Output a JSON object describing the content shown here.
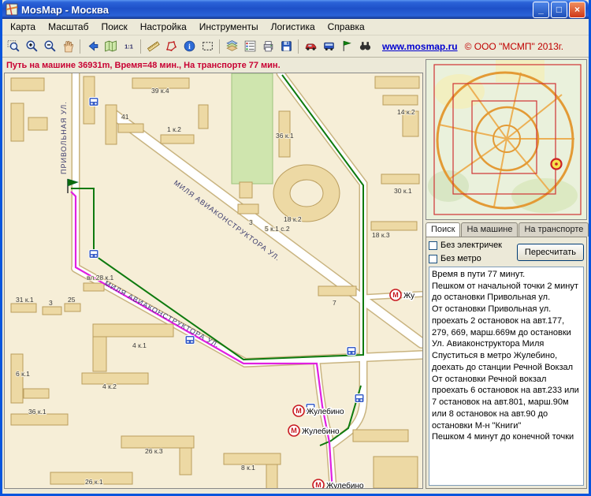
{
  "window": {
    "title": "MosMap - Москва",
    "controls": {
      "minimize": "_",
      "maximize": "□",
      "close": "×"
    }
  },
  "menu": {
    "items": [
      "Карта",
      "Масштаб",
      "Поиск",
      "Настройка",
      "Инструменты",
      "Логистика",
      "Справка"
    ]
  },
  "toolbar": {
    "icons": [
      "zoom-window",
      "zoom-in",
      "zoom-out",
      "pan-hand",
      "previous-view",
      "full-extent",
      "scale",
      "ruler",
      "measure-area",
      "object-info",
      "select-area",
      "layers",
      "legend",
      "print",
      "save",
      "car-route",
      "bus-route",
      "start-flag",
      "find-binoculars"
    ],
    "link": "www.mosmap.ru",
    "copyright": "© ООО \"МСМП\" 2013г."
  },
  "statusbar": {
    "route_summary": "Путь на машине 36931m, Время=48 мин., На транспорте 77 мин."
  },
  "map": {
    "streets": [
      "ПРИВОЛЬНАЯ УЛ.",
      "МИЛЯ АВИАКОНСТРУКТОРА УЛ.",
      "МИЛЯ АВИАКОНСТРУКТОРА УЛ."
    ],
    "buildings": [
      "39 к.4",
      "41",
      "1 к.2",
      "36 к.1",
      "14 к.2",
      "30 к.1",
      "18 к.2",
      "3",
      "5 к.1 с.2",
      "18 к.3",
      "7",
      "вл.28 к.1",
      "31 к.1",
      "3",
      "25",
      "4 к.1",
      "4 к.2",
      "6 к.1",
      "36 к.1",
      "26 к.3",
      "8 к.1",
      "26 к.1"
    ],
    "metro_stations": [
      "Жулебино",
      "Жулебино",
      "Жулебино",
      "Жу"
    ],
    "colors": {
      "car_route": "#E020E0",
      "transit_route": "#0E7A0E"
    }
  },
  "panel": {
    "tabs": [
      "Поиск",
      "На машине",
      "На транспорте"
    ],
    "options": {
      "no_trains": "Без электричек",
      "no_metro": "Без метро",
      "recalc": "Пересчитать"
    },
    "route_text": "Время в пути 77 минут.\nПешком от начальной точки 2 минут\nдо остановки Привольная ул.\nОт остановки Привольная ул.\nпроехать 2 остановок на  авт.177,\n279, 669,  марш.669м до остановки\nУл. Авиаконструктора Миля\nСпуститься в метро Жулебино,\nдоехать до станции Речной Вокзал\nОт остановки Речной вокзал\nпроехать 6 остановок на  авт.233 или\n7 остановок на  авт.801,  марш.90м\nили 8 остановок на  авт.90 до\nостановки М-н \"Книги\"\nПешком 4 минут до конечной точки"
  }
}
